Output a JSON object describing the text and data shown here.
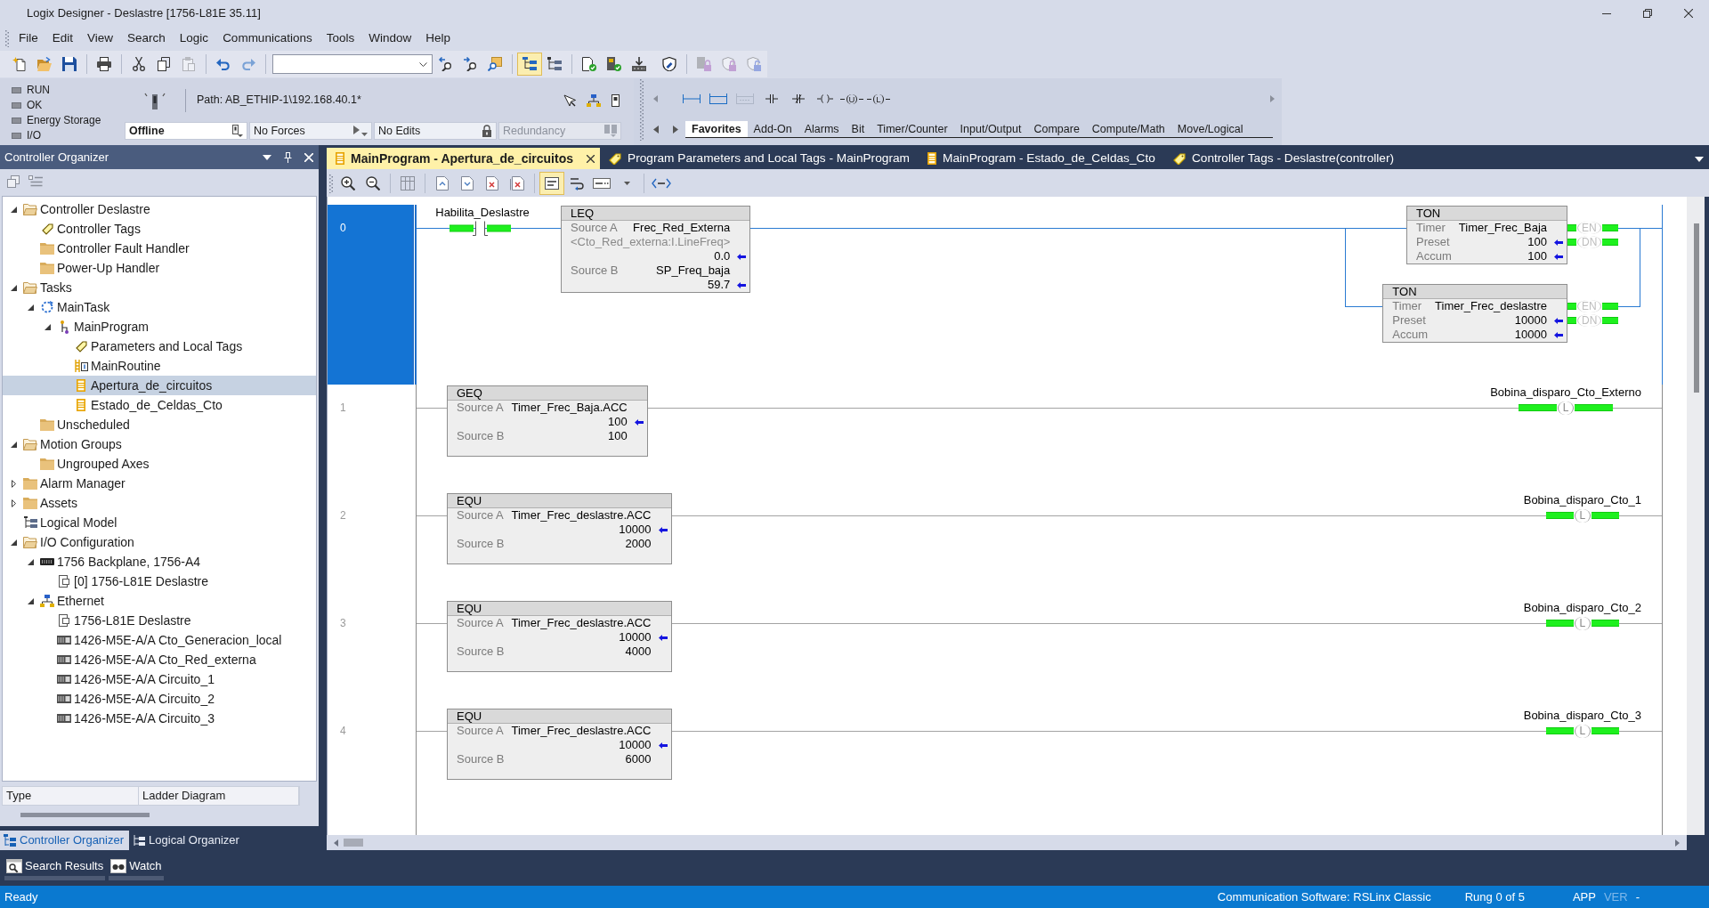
{
  "window": {
    "title": "Logix Designer - Deslastre [1756-L81E 35.11]"
  },
  "menu": [
    "File",
    "Edit",
    "View",
    "Search",
    "Logic",
    "Communications",
    "Tools",
    "Window",
    "Help"
  ],
  "toolbar": [
    {
      "kind": "grip"
    },
    {
      "kind": "new",
      "pressed": false,
      "disabled": false
    },
    {
      "kind": "open",
      "pressed": false,
      "disabled": false
    },
    {
      "kind": "save",
      "pressed": false,
      "disabled": false
    },
    {
      "kind": "separator"
    },
    {
      "kind": "print",
      "pressed": false,
      "disabled": false
    },
    {
      "kind": "separator"
    },
    {
      "kind": "cut",
      "pressed": false,
      "disabled": false
    },
    {
      "kind": "copy",
      "pressed": false,
      "disabled": false
    },
    {
      "kind": "paste",
      "pressed": false,
      "disabled": true
    },
    {
      "kind": "separator"
    },
    {
      "kind": "undo",
      "pressed": false,
      "disabled": false
    },
    {
      "kind": "redo",
      "pressed": false,
      "disabled": false
    },
    {
      "kind": "separator"
    },
    {
      "kind": "combo"
    },
    {
      "kind": "find-previous",
      "pressed": false,
      "disabled": false
    },
    {
      "kind": "find-next",
      "pressed": false,
      "disabled": false
    },
    {
      "kind": "browse",
      "pressed": false,
      "disabled": false
    },
    {
      "kind": "separator"
    },
    {
      "kind": "organizer",
      "pressed": true,
      "disabled": false
    },
    {
      "kind": "logical-organizer",
      "pressed": false,
      "disabled": false
    },
    {
      "kind": "separator"
    },
    {
      "kind": "verify-controller",
      "pressed": false,
      "disabled": false
    },
    {
      "kind": "verify-routine",
      "pressed": false,
      "disabled": false
    },
    {
      "kind": "download",
      "pressed": false,
      "disabled": false
    },
    {
      "kind": "grip"
    },
    {
      "kind": "security",
      "pressed": false,
      "disabled": false
    },
    {
      "kind": "separator"
    },
    {
      "kind": "lock-module",
      "pressed": false,
      "disabled": true
    },
    {
      "kind": "lock",
      "pressed": false,
      "disabled": true
    },
    {
      "kind": "unlock",
      "pressed": false,
      "disabled": true
    }
  ],
  "controller_status": {
    "indicators": [
      {
        "label": "RUN",
        "lit": false
      },
      {
        "label": "OK",
        "lit": false
      },
      {
        "label": "Energy Storage",
        "lit": false
      },
      {
        "label": "I/O",
        "lit": false
      }
    ],
    "path": "Path: AB_ETHIP-1\\192.168.40.1*",
    "fields": [
      {
        "kind": "mode",
        "value": "Offline",
        "disabled": false
      },
      {
        "kind": "forces",
        "value": "No Forces",
        "disabled": false
      },
      {
        "kind": "edits",
        "value": "No Edits",
        "disabled": false
      },
      {
        "kind": "redundancy",
        "value": "Redundancy",
        "disabled": true
      }
    ]
  },
  "instruction_palette": {
    "buttons": [
      {
        "kind": "rung",
        "disabled": false
      },
      {
        "kind": "branch",
        "disabled": false
      },
      {
        "kind": "branch-level",
        "disabled": true
      },
      {
        "kind": "xic",
        "disabled": false
      },
      {
        "kind": "xio",
        "disabled": false
      },
      {
        "kind": "ote",
        "disabled": false
      },
      {
        "kind": "otu",
        "symbol": "U",
        "disabled": false
      },
      {
        "kind": "otl",
        "symbol": "L",
        "disabled": false
      }
    ],
    "tabs": [
      {
        "label": "Favorites",
        "selected": true
      },
      {
        "label": "Add-On",
        "selected": false
      },
      {
        "label": "Alarms",
        "selected": false
      },
      {
        "label": "Bit",
        "selected": false
      },
      {
        "label": "Timer/Counter",
        "selected": false
      },
      {
        "label": "Input/Output",
        "selected": false
      },
      {
        "label": "Compare",
        "selected": false
      },
      {
        "label": "Compute/Math",
        "selected": false
      },
      {
        "label": "Move/Logical",
        "selected": false
      }
    ]
  },
  "organizer": {
    "title": "Controller Organizer",
    "tree": [
      {
        "label": "Controller Deslastre",
        "kind": "folder",
        "expanded": true,
        "selected": false,
        "children": [
          {
            "label": "Controller Tags",
            "kind": "tag",
            "selected": false
          },
          {
            "label": "Controller Fault Handler",
            "kind": "folder",
            "selected": false
          },
          {
            "label": "Power-Up Handler",
            "kind": "folder",
            "selected": false
          }
        ]
      },
      {
        "label": "Tasks",
        "kind": "folder",
        "expanded": true,
        "selected": false,
        "children": [
          {
            "label": "MainTask",
            "kind": "task",
            "expanded": true,
            "selected": false,
            "children": [
              {
                "label": "MainProgram",
                "kind": "program",
                "expanded": true,
                "selected": false,
                "children": [
                  {
                    "label": "Parameters and Local Tags",
                    "kind": "tag",
                    "selected": false
                  },
                  {
                    "label": "MainRoutine",
                    "kind": "main-routine",
                    "selected": false
                  },
                  {
                    "label": "Apertura_de_circuitos",
                    "kind": "routine",
                    "selected": true
                  },
                  {
                    "label": "Estado_de_Celdas_Cto",
                    "kind": "routine",
                    "selected": false
                  }
                ]
              }
            ]
          },
          {
            "label": "Unscheduled",
            "kind": "folder",
            "selected": false
          }
        ]
      },
      {
        "label": "Motion Groups",
        "kind": "folder",
        "expanded": true,
        "selected": false,
        "children": [
          {
            "label": "Ungrouped Axes",
            "kind": "folder",
            "selected": false
          }
        ]
      },
      {
        "label": "Alarm Manager",
        "kind": "folder",
        "expanded": false,
        "selected": false
      },
      {
        "label": "Assets",
        "kind": "folder",
        "expanded": false,
        "selected": false
      },
      {
        "label": "Logical Model",
        "kind": "logical-model",
        "selected": false
      },
      {
        "label": "I/O Configuration",
        "kind": "folder",
        "expanded": true,
        "selected": false,
        "children": [
          {
            "label": "1756 Backplane, 1756-A4",
            "kind": "backplane",
            "expanded": true,
            "selected": false,
            "children": [
              {
                "label": "[0] 1756-L81E Deslastre",
                "kind": "module",
                "selected": false
              }
            ]
          },
          {
            "label": "Ethernet",
            "kind": "network",
            "expanded": true,
            "selected": false,
            "children": [
              {
                "label": "1756-L81E Deslastre",
                "kind": "module",
                "selected": false
              },
              {
                "label": "1426-M5E-A/A Cto_Generacion_local",
                "kind": "io-module",
                "selected": false
              },
              {
                "label": "1426-M5E-A/A Cto_Red_externa",
                "kind": "io-module",
                "selected": false
              },
              {
                "label": "1426-M5E-A/A Circuito_1",
                "kind": "io-module",
                "selected": false
              },
              {
                "label": "1426-M5E-A/A Circuito_2",
                "kind": "io-module",
                "selected": false
              },
              {
                "label": "1426-M5E-A/A Circuito_3",
                "kind": "io-module",
                "selected": false
              }
            ]
          }
        ]
      }
    ],
    "properties": [
      {
        "label": "Type",
        "value": "Ladder Diagram"
      }
    ],
    "tabs": [
      {
        "label": "Controller Organizer",
        "kind": "controller",
        "selected": true
      },
      {
        "label": "Logical Organizer",
        "kind": "logical",
        "selected": false
      }
    ]
  },
  "editor_tabs": [
    {
      "label": "MainProgram - Apertura_de_circuitos",
      "kind": "routine",
      "selected": true
    },
    {
      "label": "Program Parameters and Local Tags - MainProgram",
      "kind": "tags",
      "selected": false
    },
    {
      "label": "MainProgram - Estado_de_Celdas_Cto",
      "kind": "routine",
      "selected": false
    },
    {
      "label": "Controller Tags - Deslastre(controller)",
      "kind": "tags",
      "selected": false
    }
  ],
  "editor_toolbar": [
    {
      "kind": "grip"
    },
    {
      "kind": "zoom-in",
      "pressed": false
    },
    {
      "kind": "zoom-out",
      "pressed": false
    },
    {
      "kind": "separator"
    },
    {
      "kind": "structure",
      "pressed": false
    },
    {
      "kind": "separator"
    },
    {
      "kind": "rung-up",
      "pressed": false
    },
    {
      "kind": "rung-down",
      "pressed": false
    },
    {
      "kind": "delete-rung",
      "pressed": false
    },
    {
      "kind": "delete-all",
      "pressed": false
    },
    {
      "kind": "separator"
    },
    {
      "kind": "description",
      "pressed": true
    },
    {
      "kind": "wrap",
      "pressed": false
    },
    {
      "kind": "text-options",
      "pressed": false
    },
    {
      "kind": "dropdown",
      "pressed": false
    },
    {
      "kind": "separator"
    },
    {
      "kind": "tag-text",
      "pressed": false
    }
  ],
  "rungs": [
    {
      "number": "0",
      "selected": true,
      "inputs": [
        {
          "kind": "xic",
          "tag": "Habilita_Deslastre",
          "energized": true
        },
        {
          "kind": "compare",
          "mnemonic": "LEQ",
          "rows": [
            {
              "kind": "operand",
              "label": "Source A",
              "text": "Frec_Red_Externa",
              "arrow": false
            },
            {
              "kind": "description",
              "text": "<Cto_Red_externa:I.LineFreq>",
              "arrow": false
            },
            {
              "kind": "value",
              "text": "0.0",
              "arrow": true
            },
            {
              "kind": "operand",
              "label": "Source B",
              "text": "SP_Freq_baja",
              "arrow": false
            },
            {
              "kind": "value",
              "text": "59.7",
              "arrow": true
            }
          ]
        }
      ],
      "outputs": [
        {
          "kind": "timer",
          "mnemonic": "TON",
          "rows": [
            {
              "kind": "operand",
              "label": "Timer",
              "text": "Timer_Frec_Baja",
              "arrow": false
            },
            {
              "kind": "operand",
              "label": "Preset",
              "text": "100",
              "arrow": true
            },
            {
              "kind": "operand",
              "label": "Accum",
              "text": "100",
              "arrow": true
            }
          ],
          "bits": [
            {
              "label": "EN",
              "energized": true
            },
            {
              "label": "DN",
              "energized": true
            }
          ]
        },
        {
          "kind": "timer",
          "mnemonic": "TON",
          "rows": [
            {
              "kind": "operand",
              "label": "Timer",
              "text": "Timer_Frec_deslastre",
              "arrow": false
            },
            {
              "kind": "operand",
              "label": "Preset",
              "text": "10000",
              "arrow": true
            },
            {
              "kind": "operand",
              "label": "Accum",
              "text": "10000",
              "arrow": true
            }
          ],
          "bits": [
            {
              "label": "EN",
              "energized": true
            },
            {
              "label": "DN",
              "energized": true
            }
          ]
        }
      ]
    },
    {
      "number": "1",
      "selected": false,
      "inputs": [
        {
          "kind": "compare",
          "mnemonic": "GEQ",
          "rows": [
            {
              "kind": "operand",
              "label": "Source A",
              "text": "Timer_Frec_Baja.ACC",
              "arrow": false
            },
            {
              "kind": "value",
              "text": "100",
              "arrow": true
            },
            {
              "kind": "operand",
              "label": "Source B",
              "text": "100",
              "arrow": false
            }
          ]
        }
      ],
      "outputs": [
        {
          "kind": "otl",
          "tag": "Bobina_disparo_Cto_Externo",
          "symbol": "L",
          "energized": true
        }
      ]
    },
    {
      "number": "2",
      "selected": false,
      "inputs": [
        {
          "kind": "compare",
          "mnemonic": "EQU",
          "rows": [
            {
              "kind": "operand",
              "label": "Source A",
              "text": "Timer_Frec_deslastre.ACC",
              "arrow": false
            },
            {
              "kind": "value",
              "text": "10000",
              "arrow": true
            },
            {
              "kind": "operand",
              "label": "Source B",
              "text": "2000",
              "arrow": false
            }
          ]
        }
      ],
      "outputs": [
        {
          "kind": "otl",
          "tag": "Bobina_disparo_Cto_1",
          "symbol": "L",
          "energized": true
        }
      ]
    },
    {
      "number": "3",
      "selected": false,
      "inputs": [
        {
          "kind": "compare",
          "mnemonic": "EQU",
          "rows": [
            {
              "kind": "operand",
              "label": "Source A",
              "text": "Timer_Frec_deslastre.ACC",
              "arrow": false
            },
            {
              "kind": "value",
              "text": "10000",
              "arrow": true
            },
            {
              "kind": "operand",
              "label": "Source B",
              "text": "4000",
              "arrow": false
            }
          ]
        }
      ],
      "outputs": [
        {
          "kind": "otl",
          "tag": "Bobina_disparo_Cto_2",
          "symbol": "L",
          "energized": true
        }
      ]
    },
    {
      "number": "4",
      "selected": false,
      "inputs": [
        {
          "kind": "compare",
          "mnemonic": "EQU",
          "rows": [
            {
              "kind": "operand",
              "label": "Source A",
              "text": "Timer_Frec_deslastre.ACC",
              "arrow": false
            },
            {
              "kind": "value",
              "text": "10000",
              "arrow": true
            },
            {
              "kind": "operand",
              "label": "Source B",
              "text": "6000",
              "arrow": false
            }
          ]
        }
      ],
      "outputs": [
        {
          "kind": "otl",
          "tag": "Bobina_disparo_Cto_3",
          "symbol": "L",
          "energized": true
        }
      ]
    }
  ],
  "bottom_tabs": [
    {
      "label": "Search Results",
      "kind": "search"
    },
    {
      "label": "Watch",
      "kind": "watch"
    }
  ],
  "status_bar": {
    "message": "Ready",
    "communication": "Communication Software: RSLinx Classic",
    "rung": "Rung 0 of 5",
    "indicators": [
      {
        "text": "APP",
        "dimmed": false
      },
      {
        "text": "VER",
        "dimmed": true
      },
      {
        "text": "-",
        "dimmed": false
      }
    ]
  }
}
